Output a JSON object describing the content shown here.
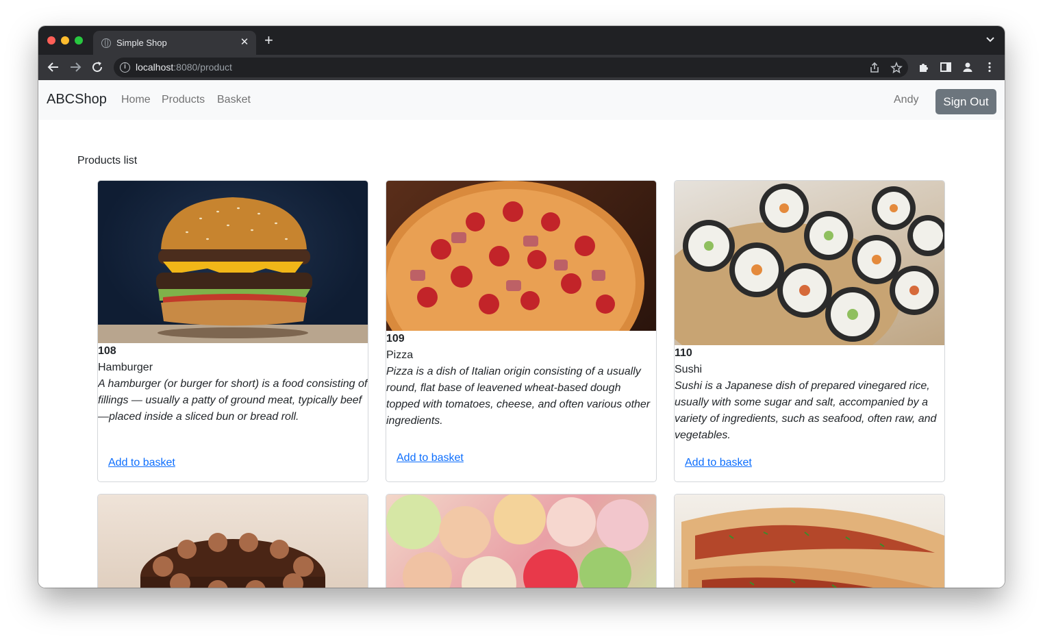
{
  "browser": {
    "tab_title": "Simple Shop",
    "new_tab": "+",
    "tab_close": "✕",
    "url_host": "localhost",
    "url_rest": ":8080/product"
  },
  "navbar": {
    "brand": "ABCShop",
    "links": [
      "Home",
      "Products",
      "Basket"
    ],
    "user": "Andy",
    "signout": "Sign Out"
  },
  "main": {
    "list_title": "Products list",
    "add_label": "Add to basket",
    "products": [
      {
        "id": "108",
        "name": "Hamburger",
        "description": "A hamburger (or burger for short) is a food consisting of fillings — usually a patty of ground meat, typically beef—placed inside a sliced bun or bread roll.",
        "image": "hamburger-photo"
      },
      {
        "id": "109",
        "name": "Pizza",
        "description": "Pizza is a dish of Italian origin consisting of a usually round, flat base of leavened wheat-based dough topped with tomatoes, cheese, and often various other ingredients.",
        "image": "pizza-photo"
      },
      {
        "id": "110",
        "name": "Sushi",
        "description": "Sushi is a Japanese dish of prepared vinegared rice, usually with some sugar and salt, accompanied by a variety of ingredients, such as seafood, often raw, and vegetables.",
        "image": "sushi-photo"
      },
      {
        "image": "cake-photo"
      },
      {
        "image": "candy-photo"
      },
      {
        "image": "hotdog-photo"
      }
    ]
  },
  "colors": {
    "link": "#0d6efd",
    "signout_bg": "#6c757d",
    "navbar_bg": "#f8f9fa",
    "chrome_dark": "#202124"
  }
}
